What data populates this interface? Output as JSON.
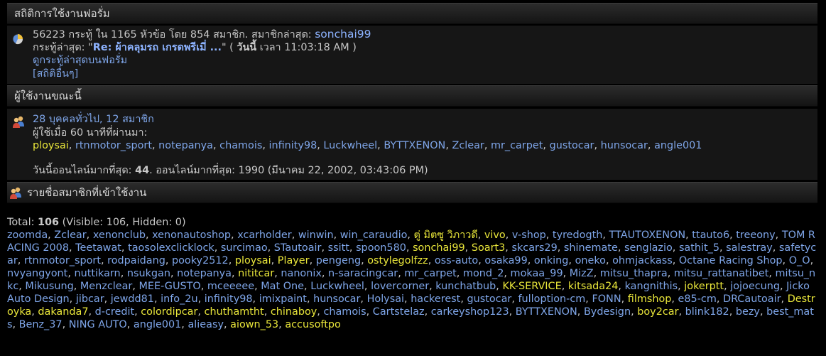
{
  "stats": {
    "header": "สถิติการใช้งานฟอรั่ม",
    "line1_prefix": "56223 กระทู้ ใน 1165 หัวข้อ โดย 854 สมาชิก. สมาชิกล่าสุด: ",
    "latest_member": "sonchai99",
    "line2_prefix": "กระทู้ล่าสุด: ",
    "latest_post_quote_open": "\"",
    "latest_post": "Re: ผ้าคลุมรถ เกรดพรีเมี่ ...",
    "latest_post_quote_close": "\"",
    "latest_post_when_open": " ( ",
    "latest_post_today": "วันนี้",
    "latest_post_time": " เวลา 11:03:18 AM )",
    "recent_posts_link": "ดูกระทู้ล่าสุดบนฟอรั่ม",
    "more_stats_link": "[สถิติอื่นๆ]"
  },
  "online": {
    "header": "ผู้ใช้งานขณะนี้",
    "summary_link": "28 บุคคลทั่วไป, 12 สมาชิก",
    "last_60_label": "ผู้ใช้เมื่อ 60 นาทีที่ผ่านมา:",
    "users": [
      {
        "name": "ploysai",
        "hl": true
      },
      {
        "name": "rtnmotor_sport",
        "hl": false
      },
      {
        "name": "notepanya",
        "hl": false
      },
      {
        "name": "chamois",
        "hl": false
      },
      {
        "name": "infinity98",
        "hl": false
      },
      {
        "name": "Luckwheel",
        "hl": false
      },
      {
        "name": "BYTTXENON",
        "hl": false
      },
      {
        "name": "Zclear",
        "hl": false
      },
      {
        "name": "mr_carpet",
        "hl": false
      },
      {
        "name": "gustocar",
        "hl": false
      },
      {
        "name": "hunsocar",
        "hl": false
      },
      {
        "name": "angle001",
        "hl": false
      }
    ],
    "record_prefix": "วันนี้ออนไลน์มากที่สุด: ",
    "record_today": "44",
    "record_rest": ". ออนไลน์มากที่สุด: 1990 (มีนาคม 22, 2002, 03:43:06 PM)"
  },
  "members": {
    "header": "รายชื่อสมาชิกที่เข้าใช้งาน",
    "total_label": "Total: ",
    "total_value": "106",
    "total_rest": " (Visible: 106, Hidden: 0)",
    "users": [
      {
        "name": "zoomda",
        "hl": false
      },
      {
        "name": "Zclear",
        "hl": false
      },
      {
        "name": "xenonclub",
        "hl": false
      },
      {
        "name": "xenonautoshop",
        "hl": false
      },
      {
        "name": "xcarholder",
        "hl": false
      },
      {
        "name": "winwin",
        "hl": false
      },
      {
        "name": "win_caraudio",
        "hl": false
      },
      {
        "name": "ตู่ มิตซู วิภาวดี",
        "hl": true
      },
      {
        "name": "vivo",
        "hl": true
      },
      {
        "name": "v-shop",
        "hl": false
      },
      {
        "name": "tyredogth",
        "hl": false
      },
      {
        "name": "TTAUTOXENON",
        "hl": false
      },
      {
        "name": "ttauto6",
        "hl": false
      },
      {
        "name": "treeony",
        "hl": false
      },
      {
        "name": "TOM RACING 2008",
        "hl": false
      },
      {
        "name": "Teetawat",
        "hl": false
      },
      {
        "name": "taosolexclicklock",
        "hl": false
      },
      {
        "name": "surcimao",
        "hl": false
      },
      {
        "name": "STautoair",
        "hl": false
      },
      {
        "name": "ssitt",
        "hl": false
      },
      {
        "name": "spoon580",
        "hl": false
      },
      {
        "name": "sonchai99",
        "hl": true
      },
      {
        "name": "Soart3",
        "hl": true
      },
      {
        "name": "skcars29",
        "hl": false
      },
      {
        "name": "shinemate",
        "hl": false
      },
      {
        "name": "senglazio",
        "hl": false
      },
      {
        "name": "sathit_5",
        "hl": false
      },
      {
        "name": "salestray",
        "hl": false
      },
      {
        "name": "safetycar",
        "hl": false
      },
      {
        "name": "rtnmotor_sport",
        "hl": false
      },
      {
        "name": "rodpaidang",
        "hl": false
      },
      {
        "name": "pooky2512",
        "hl": false
      },
      {
        "name": "ploysai",
        "hl": true
      },
      {
        "name": "Player",
        "hl": true
      },
      {
        "name": "pengeng",
        "hl": false
      },
      {
        "name": "ostylegolfzz",
        "hl": true
      },
      {
        "name": "oss-auto",
        "hl": false
      },
      {
        "name": "osaka99",
        "hl": false
      },
      {
        "name": "onking",
        "hl": false
      },
      {
        "name": "oneko",
        "hl": false
      },
      {
        "name": "ohmjackass",
        "hl": false
      },
      {
        "name": "Octane Racing Shop",
        "hl": false
      },
      {
        "name": "O_O",
        "hl": false
      },
      {
        "name": "nvyangyont",
        "hl": false
      },
      {
        "name": "nuttikarn",
        "hl": false
      },
      {
        "name": "nsukgan",
        "hl": false
      },
      {
        "name": "notepanya",
        "hl": false
      },
      {
        "name": "nititcar",
        "hl": true
      },
      {
        "name": "nanonix",
        "hl": false
      },
      {
        "name": "n-saracingcar",
        "hl": false
      },
      {
        "name": "mr_carpet",
        "hl": false
      },
      {
        "name": "mond_2",
        "hl": false
      },
      {
        "name": "mokaa_99",
        "hl": false
      },
      {
        "name": "MizZ",
        "hl": false
      },
      {
        "name": "mitsu_thapra",
        "hl": false
      },
      {
        "name": "mitsu_rattanatibet",
        "hl": false
      },
      {
        "name": "mitsu_nkc",
        "hl": false
      },
      {
        "name": "Mikusung",
        "hl": false
      },
      {
        "name": "Menzclear",
        "hl": false
      },
      {
        "name": "MEE-GUSTO",
        "hl": false
      },
      {
        "name": "mceeeee",
        "hl": false
      },
      {
        "name": "Mat One",
        "hl": false
      },
      {
        "name": "Luckwheel",
        "hl": false
      },
      {
        "name": "lovercorner",
        "hl": false
      },
      {
        "name": "kunchatbub",
        "hl": false
      },
      {
        "name": "KK-SERVICE",
        "hl": true
      },
      {
        "name": "kitsada24",
        "hl": true
      },
      {
        "name": "kangnithis",
        "hl": false
      },
      {
        "name": "jokerptt",
        "hl": true
      },
      {
        "name": "jojoecung",
        "hl": false
      },
      {
        "name": "Jicko Auto Design",
        "hl": false
      },
      {
        "name": "jibcar",
        "hl": false
      },
      {
        "name": "jewdd81",
        "hl": false
      },
      {
        "name": "info_2u",
        "hl": false
      },
      {
        "name": "infinity98",
        "hl": false
      },
      {
        "name": "imixpaint",
        "hl": false
      },
      {
        "name": "hunsocar",
        "hl": false
      },
      {
        "name": "Holysai",
        "hl": false
      },
      {
        "name": "hackerest",
        "hl": false
      },
      {
        "name": "gustocar",
        "hl": false
      },
      {
        "name": "fulloption-cm",
        "hl": false
      },
      {
        "name": "FONN",
        "hl": false
      },
      {
        "name": "filmshop",
        "hl": true
      },
      {
        "name": "e85-cm",
        "hl": false
      },
      {
        "name": "DRCautoair",
        "hl": false
      },
      {
        "name": "Destroyka",
        "hl": true
      },
      {
        "name": "dakanda7",
        "hl": true
      },
      {
        "name": "d-credit",
        "hl": false
      },
      {
        "name": "colordipcar",
        "hl": true
      },
      {
        "name": "chuthamtht",
        "hl": true
      },
      {
        "name": "chinaboy",
        "hl": true
      },
      {
        "name": "chamois",
        "hl": false
      },
      {
        "name": "Cartstelaz",
        "hl": false
      },
      {
        "name": "carkeyshop123",
        "hl": false
      },
      {
        "name": "BYTTXENON",
        "hl": false
      },
      {
        "name": "Bydesign",
        "hl": false
      },
      {
        "name": "boy2car",
        "hl": true
      },
      {
        "name": "blink182",
        "hl": false
      },
      {
        "name": "bezy",
        "hl": false
      },
      {
        "name": "best_mats",
        "hl": false
      },
      {
        "name": "Benz_37",
        "hl": false
      },
      {
        "name": "NING AUTO",
        "hl": false
      },
      {
        "name": "angle001",
        "hl": false
      },
      {
        "name": "alieasy",
        "hl": false
      },
      {
        "name": "aiown_53",
        "hl": true
      },
      {
        "name": "accusoftpo",
        "hl": true
      }
    ]
  },
  "colors": {
    "link": "#7ea5e8",
    "highlight": "#e9e63a",
    "background": "#000000"
  }
}
